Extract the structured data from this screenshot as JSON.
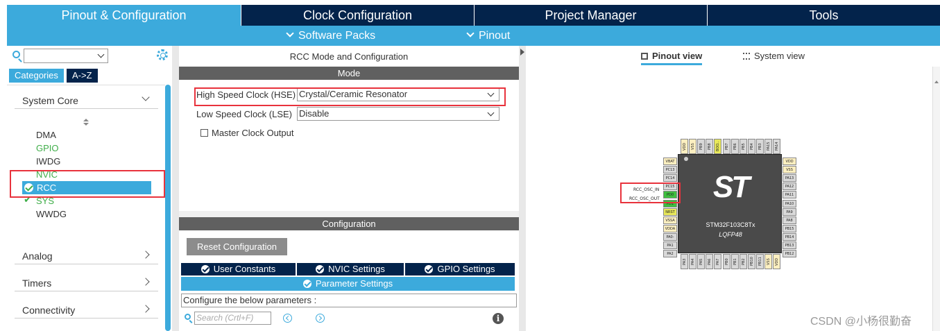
{
  "top_tabs": [
    "Pinout & Configuration",
    "Clock Configuration",
    "Project Manager",
    "Tools"
  ],
  "sub_menu": [
    "Software Packs",
    "Pinout"
  ],
  "left": {
    "category_tabs": [
      "Categories",
      "A->Z"
    ],
    "groups": [
      "System Core",
      "Analog",
      "Timers",
      "Connectivity"
    ],
    "items": [
      "DMA",
      "GPIO",
      "IWDG",
      "NVIC",
      "RCC",
      "SYS",
      "WWDG"
    ]
  },
  "mid": {
    "title": "RCC Mode and Configuration",
    "mode_header": "Mode",
    "hse_label": "High Speed Clock (HSE)",
    "hse_value": "Crystal/Ceramic Resonator",
    "lse_label": "Low Speed Clock (LSE)",
    "lse_value": "Disable",
    "mco_label": "Master Clock Output",
    "config_header": "Configuration",
    "reset_button": "Reset Configuration",
    "config_tabs": [
      "User Constants",
      "NVIC Settings",
      "GPIO Settings"
    ],
    "param_tab": "Parameter Settings",
    "param_note": "Configure the below parameters :",
    "search_placeholder": "Search (Crtl+F)",
    "info": "i"
  },
  "right": {
    "view_tabs": [
      "Pinout view",
      "System view"
    ],
    "chip_part": "STM32F103C8Tx",
    "chip_package": "LQFP48",
    "chip_logo": "ST",
    "pin_labels": [
      "RCC_OSC_IN",
      "RCC_OSC_OUT"
    ],
    "top_pins": [
      "VDD",
      "VSS",
      "PB9",
      "PB8",
      "BOO..",
      "PB7",
      "PB6",
      "PB5",
      "PB4",
      "PB3",
      "PA15",
      "PA14"
    ],
    "left_pins": [
      "VBAT",
      "PC13",
      "PC14",
      "PC15",
      "PD0",
      "PD1",
      "NRST",
      "VSSA",
      "VDDA",
      "PA0-",
      "PA1",
      "PA2"
    ],
    "right_pins": [
      "VDD",
      "VSS",
      "PA13",
      "PA12",
      "PA11",
      "PA10",
      "PA9",
      "PA8",
      "PB15",
      "PB14",
      "PB13",
      "PB12"
    ],
    "bottom_pins": [
      "PA3",
      "PA4",
      "PA5",
      "PA6",
      "PA7",
      "PB0",
      "PB1",
      "PB2",
      "PB10",
      "PB11",
      "VSS",
      "VDD"
    ]
  },
  "watermark": "CSDN @小杨很勤奋",
  "colors": {
    "navy": "#03234b",
    "accent": "#3caadc",
    "green": "#3fae49",
    "highlight": "#e8323c"
  }
}
